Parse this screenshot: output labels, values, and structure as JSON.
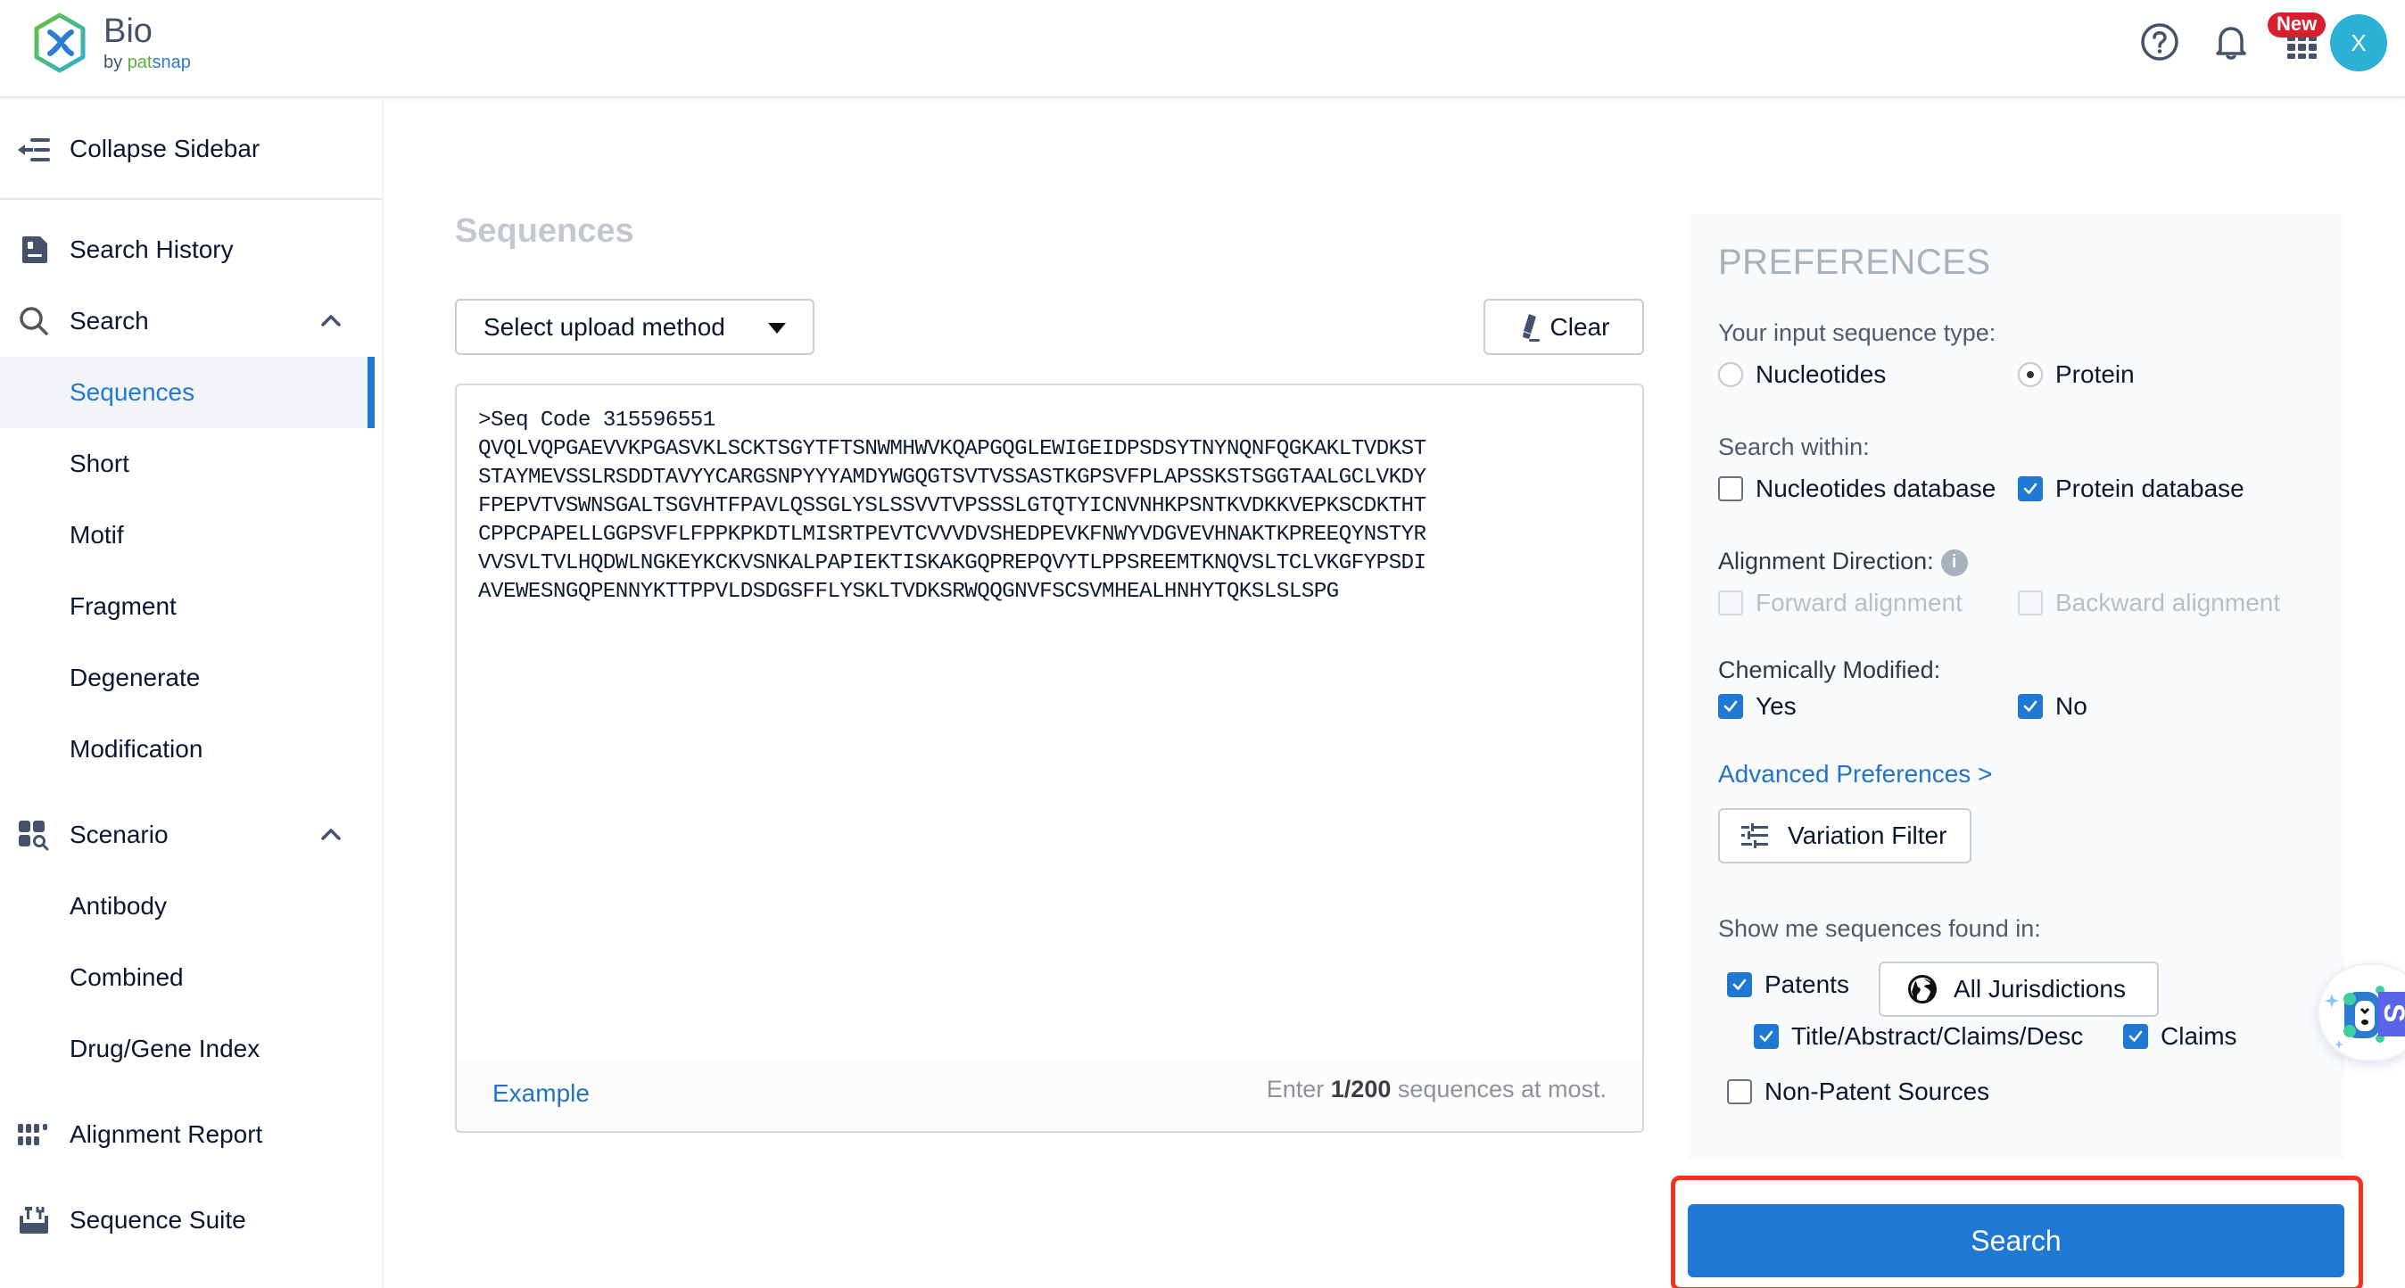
{
  "header": {
    "logo_title": "Bio",
    "logo_by": "by ",
    "logo_brand_a": "pat",
    "logo_brand_b": "snap",
    "new_badge": "New",
    "avatar_initial": "X",
    "icons": [
      "help-icon",
      "bell-icon",
      "apps-grid-icon"
    ]
  },
  "sidebar": {
    "collapse_label": "Collapse Sidebar",
    "items": [
      {
        "label": "Search History",
        "icon": "search-history-icon"
      },
      {
        "label": "Search",
        "icon": "search-icon",
        "expanded": true,
        "children": [
          "Sequences",
          "Short",
          "Motif",
          "Fragment",
          "Degenerate",
          "Modification"
        ],
        "active_child": "Sequences"
      },
      {
        "label": "Scenario",
        "icon": "scenario-icon",
        "expanded": true,
        "children": [
          "Antibody",
          "Combined",
          "Drug/Gene Index"
        ]
      },
      {
        "label": "Alignment Report",
        "icon": "alignment-report-icon"
      },
      {
        "label": "Sequence Suite",
        "icon": "sequence-suite-icon"
      }
    ]
  },
  "main": {
    "title": "Sequences",
    "upload_select": {
      "selected": "Select upload method"
    },
    "clear_label": "Clear",
    "sequence_input": ">Seq Code 315596551\nQVQLVQPGAEVVKPGASVKLSCKTSGYTFTSNWMHWVKQAPGQGLEWIGEIDPSDSYTNYNQNFQGKAKLTVDKST\nSTAYMEVSSLRSDDTAVYYCARGSNPYYYAMDYWGQGTSVTVSSASTKGPSVFPLAPSSKSTSGGTAALGCLVKDY\nFPEPVTVSWNSGALTSGVHTFPAVLQSSGLYSLSSVVTVPSSSLGTQTYICNVNHKPSNTKVDKKVEPKSCDKTHT\nCPPCPAPELLGGPSVFLFPPKPKDTLMISRTPEVTCVVVDVSHEDPEVKFNWYVDGVEVHNAKTKPREEQYNSTYR\nVVSVLTVLHQDWLNGKEYKCKVSNKALPAPIEKTISKAKGQPREPQVYTLPPSREEMTKNQVSLTCLVKGFYPSDI\nAVEWESNGQPENNYKTTPPVLDSDGSFFLYSKLTVDKSRWQQGNVFSCSVMHEALHNHYTQKSLSLSPG",
    "example_label": "Example",
    "limit_prefix": "Enter ",
    "limit_count": "1/200",
    "limit_suffix": " sequences at most."
  },
  "preferences": {
    "title": "PREFERENCES",
    "sequence_type": {
      "label": "Your input sequence type:",
      "options": [
        {
          "label": "Nucleotides",
          "selected": false
        },
        {
          "label": "Protein",
          "selected": true
        }
      ]
    },
    "search_within": {
      "label": "Search within:",
      "options": [
        {
          "label": "Nucleotides database",
          "checked": false
        },
        {
          "label": "Protein database",
          "checked": true
        }
      ]
    },
    "alignment_direction": {
      "label": "Alignment Direction:",
      "options": [
        {
          "label": "Forward alignment",
          "checked": false,
          "disabled": true
        },
        {
          "label": "Backward alignment",
          "checked": false,
          "disabled": true
        }
      ]
    },
    "chemically_modified": {
      "label": "Chemically Modified:",
      "options": [
        {
          "label": "Yes",
          "checked": true
        },
        {
          "label": "No",
          "checked": true
        }
      ]
    },
    "advanced_link": "Advanced Preferences >",
    "variation_filter_label": "Variation Filter",
    "sources": {
      "label": "Show me sequences found in:",
      "patents": {
        "label": "Patents",
        "checked": true
      },
      "jurisdictions_label": "All Jurisdictions",
      "patent_fields": [
        {
          "label": "Title/Abstract/Claims/Desc",
          "checked": true
        },
        {
          "label": "Claims",
          "checked": true
        }
      ],
      "non_patent": {
        "label": "Non-Patent Sources",
        "checked": false
      }
    }
  },
  "search_button_label": "Search",
  "colors": {
    "accent": "#1f78d1",
    "highlight": "#f0321e",
    "badge": "#d6202f",
    "avatar": "#2bb0d6"
  }
}
